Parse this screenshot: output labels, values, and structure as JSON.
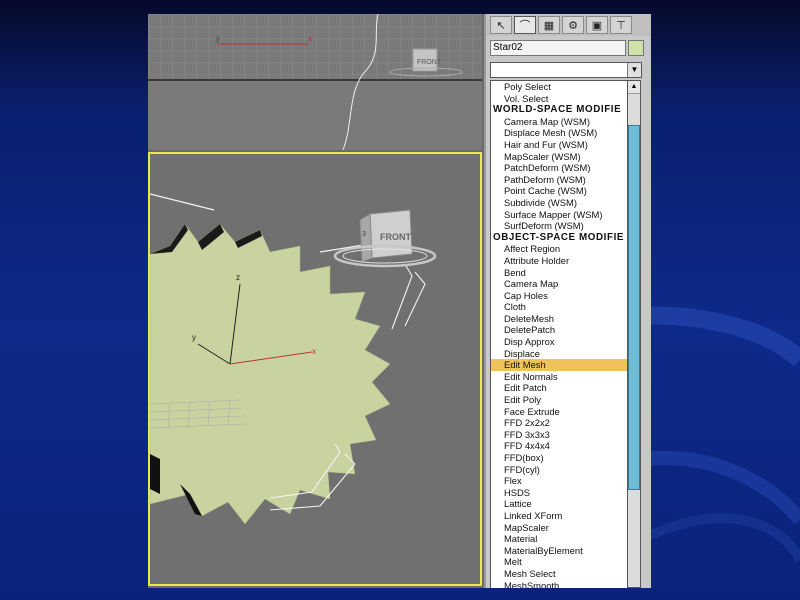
{
  "object_name": "Star02",
  "colors": {
    "selection_highlight": "#f2c25a",
    "viewport_active_border": "#e8e84a",
    "star_fill": "#c8d3a0",
    "scrollbar_thumb": "#6fbcd6"
  },
  "tabs": [
    {
      "name": "create-tab",
      "icon": "pointer-icon"
    },
    {
      "name": "modify-tab",
      "icon": "modify-arc-icon"
    },
    {
      "name": "hierarchy-tab",
      "icon": "hierarchy-icon"
    },
    {
      "name": "motion-tab",
      "icon": "motion-wheel-icon"
    },
    {
      "name": "display-tab",
      "icon": "monitor-icon"
    },
    {
      "name": "utilities-tab",
      "icon": "hammer-icon"
    }
  ],
  "viewcube": {
    "top_label": "FRONT",
    "persp_label": "FRONT",
    "side_label": "3"
  },
  "axes": {
    "x": "x",
    "y": "y",
    "z": "z"
  },
  "modifier_list": {
    "selected": "Edit Mesh",
    "items": [
      {
        "label": "Poly Select",
        "type": "item"
      },
      {
        "label": "Vol. Select",
        "type": "item"
      },
      {
        "label": "WORLD-SPACE MODIFIE",
        "type": "header"
      },
      {
        "label": "Camera Map (WSM)",
        "type": "item"
      },
      {
        "label": "Displace Mesh (WSM)",
        "type": "item"
      },
      {
        "label": "Hair and Fur (WSM)",
        "type": "item"
      },
      {
        "label": "MapScaler (WSM)",
        "type": "item"
      },
      {
        "label": "PatchDeform (WSM)",
        "type": "item"
      },
      {
        "label": "PathDeform (WSM)",
        "type": "item"
      },
      {
        "label": "Point Cache (WSM)",
        "type": "item"
      },
      {
        "label": "Subdivide (WSM)",
        "type": "item"
      },
      {
        "label": "Surface Mapper (WSM)",
        "type": "item"
      },
      {
        "label": "SurfDeform (WSM)",
        "type": "item"
      },
      {
        "label": "OBJECT-SPACE MODIFIE",
        "type": "header"
      },
      {
        "label": "Affect Region",
        "type": "item"
      },
      {
        "label": "Attribute Holder",
        "type": "item"
      },
      {
        "label": "Bend",
        "type": "item"
      },
      {
        "label": "Camera Map",
        "type": "item"
      },
      {
        "label": "Cap Holes",
        "type": "item"
      },
      {
        "label": "Cloth",
        "type": "item"
      },
      {
        "label": "DeleteMesh",
        "type": "item"
      },
      {
        "label": "DeletePatch",
        "type": "item"
      },
      {
        "label": "Disp Approx",
        "type": "item"
      },
      {
        "label": "Displace",
        "type": "item"
      },
      {
        "label": "Edit Mesh",
        "type": "item"
      },
      {
        "label": "Edit Normals",
        "type": "item"
      },
      {
        "label": "Edit Patch",
        "type": "item"
      },
      {
        "label": "Edit Poly",
        "type": "item"
      },
      {
        "label": "Face Extrude",
        "type": "item"
      },
      {
        "label": "FFD 2x2x2",
        "type": "item"
      },
      {
        "label": "FFD 3x3x3",
        "type": "item"
      },
      {
        "label": "FFD 4x4x4",
        "type": "item"
      },
      {
        "label": "FFD(box)",
        "type": "item"
      },
      {
        "label": "FFD(cyl)",
        "type": "item"
      },
      {
        "label": "Flex",
        "type": "item"
      },
      {
        "label": "HSDS",
        "type": "item"
      },
      {
        "label": "Lattice",
        "type": "item"
      },
      {
        "label": "Linked XForm",
        "type": "item"
      },
      {
        "label": "MapScaler",
        "type": "item"
      },
      {
        "label": "Material",
        "type": "item"
      },
      {
        "label": "MaterialByElement",
        "type": "item"
      },
      {
        "label": "Melt",
        "type": "item"
      },
      {
        "label": "Mesh Select",
        "type": "item"
      },
      {
        "label": "MeshSmooth",
        "type": "item"
      }
    ]
  }
}
